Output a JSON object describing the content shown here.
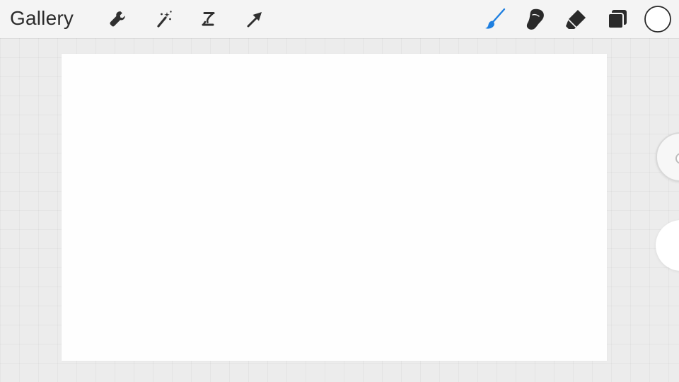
{
  "topbar": {
    "gallery_label": "Gallery",
    "left_tools": [
      {
        "name": "actions",
        "icon": "wrench-icon"
      },
      {
        "name": "adjustments",
        "icon": "magic-wand-icon"
      },
      {
        "name": "selection",
        "icon": "selection-s-icon"
      },
      {
        "name": "transform",
        "icon": "arrow-cursor-icon"
      }
    ],
    "right_tools": [
      {
        "name": "paint",
        "icon": "brush-icon",
        "active": true
      },
      {
        "name": "smudge",
        "icon": "smudge-finger-icon"
      },
      {
        "name": "erase",
        "icon": "eraser-icon"
      },
      {
        "name": "layers",
        "icon": "layers-icon"
      },
      {
        "name": "color",
        "icon": "color-swatch-icon"
      }
    ]
  },
  "colors": {
    "active_tool": "#1e7fe0",
    "icon": "#2f2f2f",
    "current_color": "#ffffff",
    "canvas": "#fefefe",
    "workspace": "#ececec"
  },
  "sidebar": {
    "sliders": [
      {
        "name": "brush-size",
        "icon": "slider-handle"
      },
      {
        "name": "opacity",
        "icon": "slider-handle"
      }
    ]
  }
}
